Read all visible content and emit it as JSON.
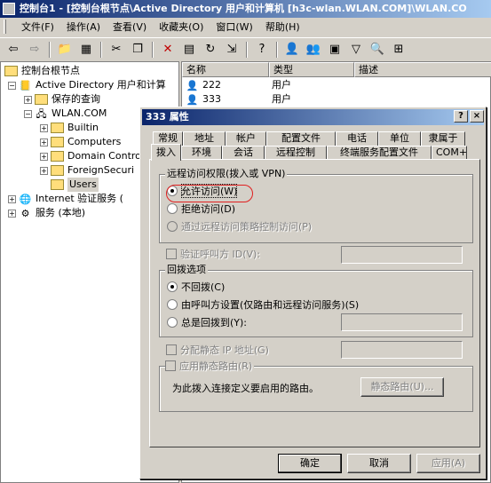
{
  "window": {
    "title": "控制台1 - [控制台根节点\\Active Directory 用户和计算机 [h3c-wlan.WLAN.COM]\\WLAN.CO"
  },
  "menu": [
    "文件(F)",
    "操作(A)",
    "查看(V)",
    "收藏夹(O)",
    "窗口(W)",
    "帮助(H)"
  ],
  "toolbar": {
    "icons": [
      "back-icon",
      "forward-icon",
      "up-folder-icon",
      "show-tree-icon",
      "cut-icon",
      "copy-icon",
      "delete-icon",
      "properties-icon",
      "refresh-icon",
      "export-icon",
      "help-icon",
      "new-user-icon",
      "new-group-icon",
      "new-ou-icon",
      "filter-icon",
      "find-icon",
      "add-to-group-icon"
    ]
  },
  "tree": {
    "root": "控制台根节点",
    "ad": "Active Directory 用户和计算",
    "saved": "保存的查询",
    "domain": "WLAN.COM",
    "children": [
      "Builtin",
      "Computers",
      "Domain Contro",
      "ForeignSecuri",
      "Users"
    ],
    "internet": "Internet 验证服务 (",
    "services": "服务 (本地)"
  },
  "list": {
    "columns": [
      "名称",
      "类型",
      "描述"
    ],
    "rows": [
      {
        "name": "222",
        "type": "用户"
      },
      {
        "name": "333",
        "type": "用户"
      }
    ]
  },
  "dialog": {
    "title": "333 属性",
    "help": "?",
    "close": "×",
    "tabs_row1": [
      "常规",
      "地址",
      "帐户",
      "配置文件",
      "电话",
      "单位",
      "隶属于"
    ],
    "tabs_row2": [
      "拨入",
      "环境",
      "会话",
      "远程控制",
      "终端服务配置文件",
      "COM+"
    ],
    "remote_access_group": "远程访问权限(拨入或 VPN)",
    "allow_access": "允许访问(W)",
    "deny_access": "拒绝访问(D)",
    "policy_access": "通过远程访问策略控制访问(P)",
    "verify_caller_id": "验证呼叫方 ID(V):",
    "callback_group": "回拨选项",
    "no_callback": "不回拨(C)",
    "caller_set": "由呼叫方设置(仅路由和远程访问服务)(S)",
    "always_callback": "总是回拨到(Y):",
    "assign_static_ip": "分配静态 IP 地址(G)",
    "apply_static_routes": "应用静态路由(R)",
    "routes_desc": "为此拨入连接定义要启用的路由。",
    "static_routes_btn": "静态路由(U)...",
    "ok": "确定",
    "cancel": "取消",
    "apply": "应用(A)"
  }
}
